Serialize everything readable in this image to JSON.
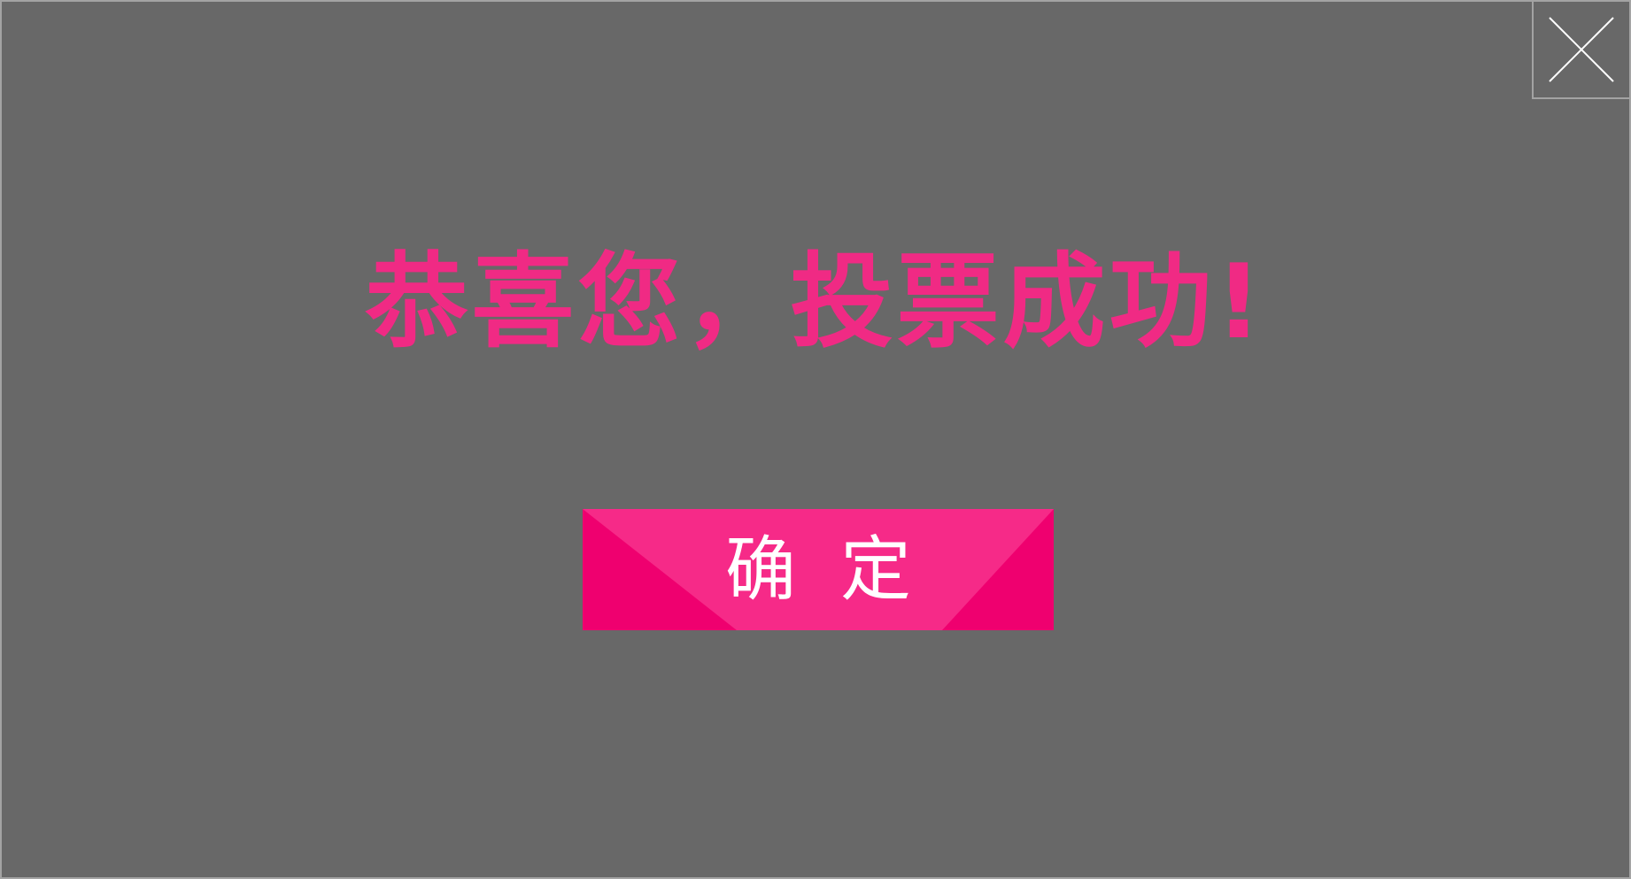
{
  "dialog": {
    "message": "恭喜您，投票成功!",
    "confirm_label": "确定",
    "close_icon": "close-icon"
  },
  "colors": {
    "overlay": "#686868",
    "border": "#a3a3a3",
    "accent": "#f02a84",
    "button_light": "#f62a88",
    "button_dark": "#ef006f",
    "button_text": "#ffffff"
  }
}
